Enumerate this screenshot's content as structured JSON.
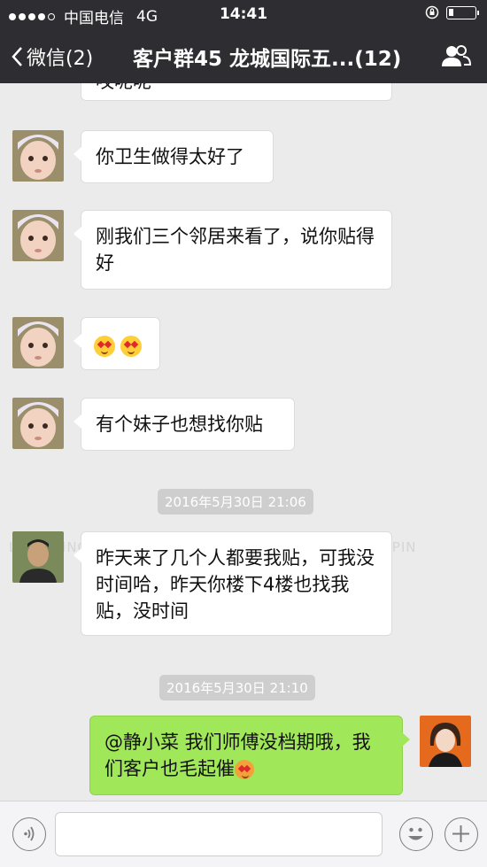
{
  "status": {
    "carrier": "中国电信",
    "network": "4G",
    "time": "14:41"
  },
  "nav": {
    "back_label": "微信(2)",
    "title": "客户群45 龙城国际五...(12)"
  },
  "messages": [
    {
      "text": "哎呢呢"
    },
    {
      "text": "你卫生做得太好了"
    },
    {
      "text": "刚我们三个邻居来看了，说你贴得好"
    },
    {
      "emoji": "heart-eyes-emoji"
    },
    {
      "text": "有个妹子也想找你贴"
    },
    {
      "timestamp": "2016年5月30日 21:06"
    },
    {
      "text": "昨天来了几个人都要我贴，可我没时间哈，昨天你楼下4楼也找我贴，没时间"
    },
    {
      "timestamp": "2016年5月30日 21:10"
    },
    {
      "text": "@静小菜 我们师傅没档期哦，我们客户也毛起催"
    }
  ],
  "watermark": "LXIAOPING.COM    WWW.LXIAOPING.COM    WWW.LXIAOPIN",
  "input": {
    "value": ""
  },
  "colors": {
    "navbar": "#2e2e32",
    "chat_bg": "#ebebeb",
    "self_bubble": "#a0e75a"
  }
}
